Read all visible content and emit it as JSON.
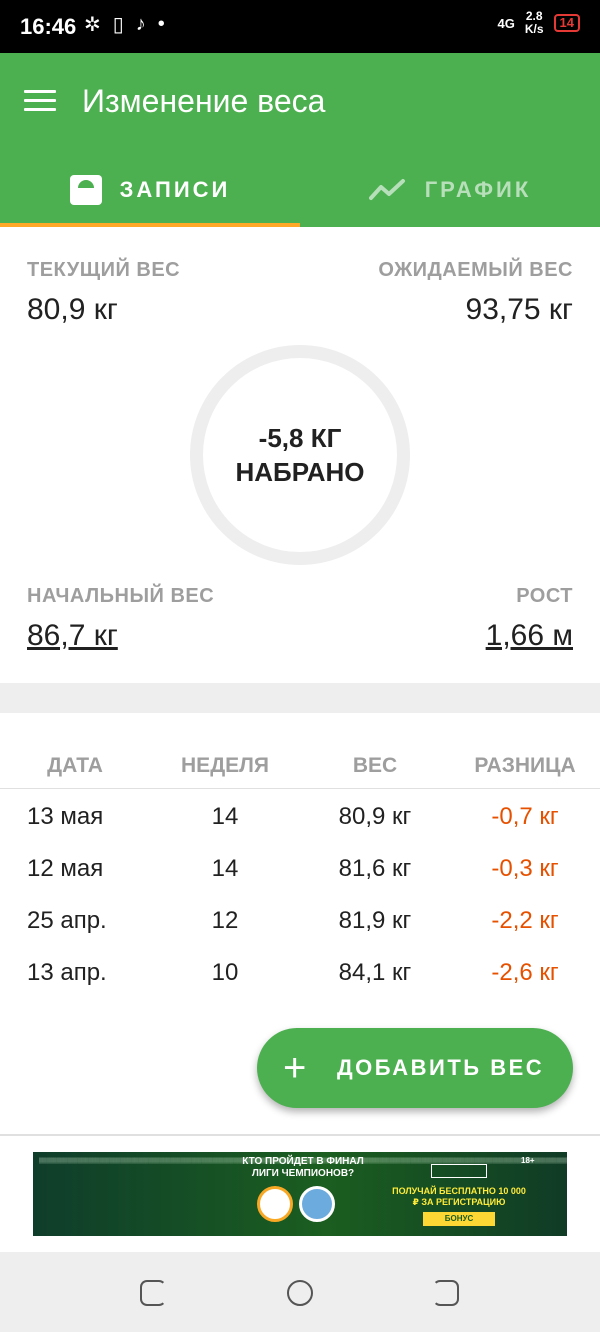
{
  "status_bar": {
    "time": "16:46",
    "network": "4G",
    "speed_value": "2.8",
    "speed_unit": "K/s",
    "battery": "14"
  },
  "app_bar": {
    "title": "Изменение веса",
    "tabs": [
      {
        "label": "ЗАПИСИ",
        "icon": "scale-icon",
        "active": true
      },
      {
        "label": "ГРАФИК",
        "icon": "chart-line-icon",
        "active": false
      }
    ]
  },
  "summary": {
    "current_label": "ТЕКУЩИЙ ВЕС",
    "current_value": "80,9 кг",
    "expected_label": "ОЖИДАЕМЫЙ ВЕС",
    "expected_value": "93,75 кг",
    "change_value": "-5,8 КГ",
    "change_label": "НАБРАНО",
    "start_label": "НАЧАЛЬНЫЙ ВЕС",
    "start_value": "86,7 кг",
    "height_label": "РОСТ",
    "height_value": "1,66 м"
  },
  "table": {
    "headers": [
      "ДАТА",
      "НЕДЕЛЯ",
      "ВЕС",
      "РАЗНИЦА"
    ],
    "rows": [
      {
        "date": "13 мая",
        "week": "14",
        "weight": "80,9 кг",
        "diff": "-0,7 кг"
      },
      {
        "date": "12 мая",
        "week": "14",
        "weight": "81,6 кг",
        "diff": "-0,3 кг"
      },
      {
        "date": "25 апр.",
        "week": "12",
        "weight": "81,9 кг",
        "diff": "-2,2 кг"
      },
      {
        "date": "13 апр.",
        "week": "10",
        "weight": "84,1 кг",
        "diff": "-2,6 кг"
      }
    ]
  },
  "fab": {
    "plus": "+",
    "label": "ДОБАВИТЬ ВЕС"
  },
  "ad": {
    "headline": "КТО ПРОЙДЕТ В ФИНАЛ ЛИГИ ЧЕМПИОНОВ?",
    "offer": "ПОЛУЧАЙ БЕСПЛАТНО 10 000 ₽ ЗА РЕГИСТРАЦИЮ",
    "bonus": "БОНУС",
    "age": "18+"
  },
  "colors": {
    "primary": "#4caf50",
    "accent": "#ffa726",
    "negative": "#e65100"
  }
}
